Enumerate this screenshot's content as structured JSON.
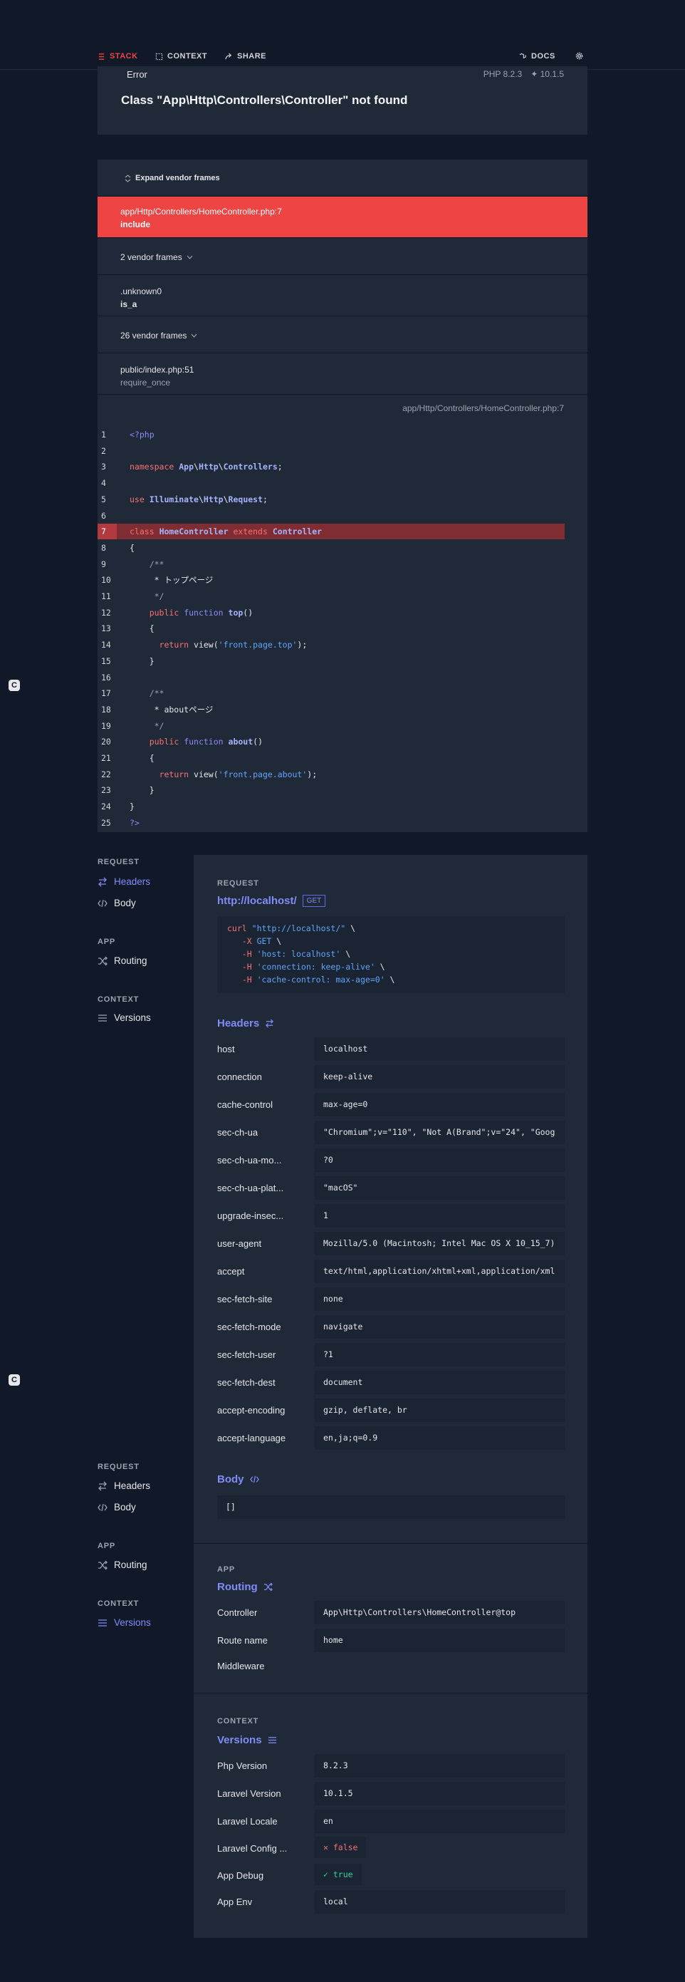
{
  "nav": {
    "stack": "STACK",
    "context": "CONTEXT",
    "share": "SHARE",
    "docs": "DOCS"
  },
  "error": {
    "badge": "Error",
    "php": "PHP 8.2.3",
    "laravel": "10.1.5",
    "title": "Class \"App\\Http\\Controllers\\Controller\" not found"
  },
  "stack": {
    "expand_label": "Expand vendor frames",
    "selected_frame": {
      "path": "app/Http/Controllers/HomeController.php",
      "line": ":7",
      "method": "include"
    },
    "vendor1": "2 vendor frames",
    "frame2": {
      "path": ".unknown0",
      "method": "is_a"
    },
    "vendor2": "26 vendor frames",
    "frame3": {
      "path": "public/index.php",
      "line": ":51",
      "method": "require_once"
    },
    "code_file": "app/Http/Controllers/HomeController.php",
    "code_line": ":7"
  },
  "code": {
    "line_numbers": [
      "1",
      "2",
      "3",
      "4",
      "5",
      "6",
      "7",
      "8",
      "9",
      "10",
      "11",
      "12",
      "13",
      "14",
      "15",
      "16",
      "17",
      "18",
      "19",
      "20",
      "21",
      "22",
      "23",
      "24",
      "25"
    ]
  },
  "sidebar": {
    "group1": {
      "title": "REQUEST",
      "items": [
        "Headers",
        "Body"
      ]
    },
    "group2": {
      "title": "APP",
      "items": [
        "Routing"
      ]
    },
    "group3": {
      "title": "CONTEXT",
      "items": [
        "Versions"
      ]
    }
  },
  "request": {
    "label": "REQUEST",
    "url": "http://localhost/",
    "method": "GET",
    "curl": [
      "curl \"http://localhost/\" \\",
      "   -X GET \\",
      "   -H 'host: localhost' \\",
      "   -H 'connection: keep-alive' \\",
      "   -H 'cache-control: max-age=0' \\"
    ],
    "headers_title": "Headers",
    "headers": [
      {
        "key": "host",
        "value": "localhost"
      },
      {
        "key": "connection",
        "value": "keep-alive"
      },
      {
        "key": "cache-control",
        "value": "max-age=0"
      },
      {
        "key": "sec-ch-ua",
        "value": "\"Chromium\";v=\"110\", \"Not A(Brand\";v=\"24\", \"Goog"
      },
      {
        "key": "sec-ch-ua-mo...",
        "value": "?0"
      },
      {
        "key": "sec-ch-ua-plat...",
        "value": "\"macOS\""
      },
      {
        "key": "upgrade-insec...",
        "value": "1"
      },
      {
        "key": "user-agent",
        "value": "Mozilla/5.0 (Macintosh; Intel Mac OS X 10_15_7)"
      },
      {
        "key": "accept",
        "value": "text/html,application/xhtml+xml,application/xml"
      },
      {
        "key": "sec-fetch-site",
        "value": "none"
      },
      {
        "key": "sec-fetch-mode",
        "value": "navigate"
      },
      {
        "key": "sec-fetch-user",
        "value": "?1"
      },
      {
        "key": "sec-fetch-dest",
        "value": "document"
      },
      {
        "key": "accept-encoding",
        "value": "gzip, deflate, br"
      },
      {
        "key": "accept-language",
        "value": "en,ja;q=0.9"
      }
    ],
    "body_title": "Body",
    "body_value": "[]"
  },
  "app": {
    "label": "APP",
    "routing_title": "Routing",
    "rows": [
      {
        "key": "Controller",
        "value": "App\\Http\\Controllers\\HomeController@top"
      },
      {
        "key": "Route name",
        "value": "home"
      },
      {
        "key": "Middleware",
        "value": ""
      }
    ]
  },
  "context": {
    "label": "CONTEXT",
    "versions_title": "Versions",
    "rows": [
      {
        "key": "Php Version",
        "value": "8.2.3"
      },
      {
        "key": "Laravel Version",
        "value": "10.1.5"
      },
      {
        "key": "Laravel Locale",
        "value": "en"
      },
      {
        "key": "Laravel Config ...",
        "value": "false"
      },
      {
        "key": "App Debug",
        "value": "true"
      },
      {
        "key": "App Env",
        "value": "local"
      }
    ]
  },
  "colors": {
    "accent": "#818cf8",
    "error": "#ef4444",
    "bg": "#111827",
    "panel": "#1f2937"
  }
}
